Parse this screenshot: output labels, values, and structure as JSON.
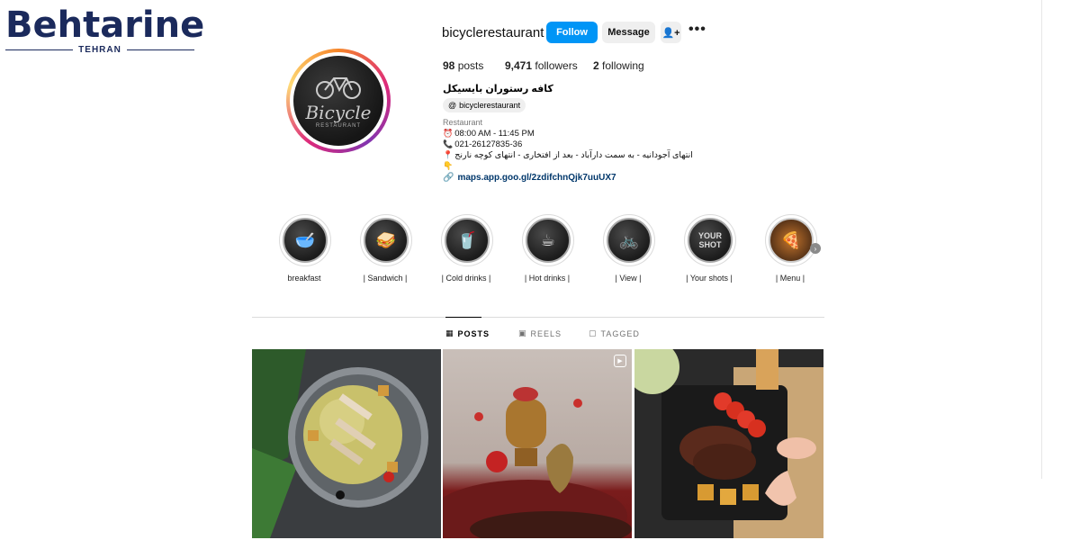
{
  "watermark": {
    "word": "Behtarine",
    "sub": "TEHRAN"
  },
  "profile": {
    "username": "bicyclerestaurant",
    "avatar_text": "Bicycle",
    "avatar_sub": "RESTAURANT",
    "buttons": {
      "follow": "Follow",
      "message": "Message",
      "add_user_icon": "👤+",
      "more": "•••"
    },
    "stats": {
      "posts_count": "98",
      "posts_label": "posts",
      "followers_count": "9,471",
      "followers_label": "followers",
      "following_count": "2",
      "following_label": "following"
    },
    "bio": {
      "name": "کافه رستوران بایسیکل",
      "threads_handle": "bicyclerestaurant",
      "category": "Restaurant",
      "hours": "08:00 AM - 11:45 PM",
      "phone": "021-26127835-36",
      "address": "انتهای آجودانیه - به سمت دارآباد - بعد از افتخاری - انتهای کوچه نارنج",
      "link": "maps.app.goo.gl/2zdifchnQjk7uuUX7"
    }
  },
  "highlights": [
    {
      "label": "breakfast",
      "icon": "bowl-icon",
      "glyph": "🥣"
    },
    {
      "label": "| Sandwich |",
      "icon": "sandwich-icon",
      "glyph": "🥪"
    },
    {
      "label": "| Cold drinks |",
      "icon": "cold-drink-icon",
      "glyph": "🥤"
    },
    {
      "label": "| Hot drinks |",
      "icon": "coffee-cup-icon",
      "glyph": "☕"
    },
    {
      "label": "| View |",
      "icon": "bicycle-icon",
      "glyph": "🚲"
    },
    {
      "label": "| Your shots |",
      "icon": "your-shot-icon",
      "glyph": "YOUR SHOT"
    },
    {
      "label": "| Menu |",
      "icon": "menu-food-icon",
      "glyph": "🍕"
    }
  ],
  "tabs": {
    "posts": "POSTS",
    "reels": "REELS",
    "tagged": "TAGGED"
  }
}
